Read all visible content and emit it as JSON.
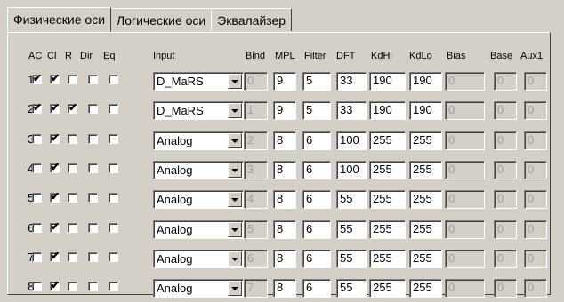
{
  "tabs": [
    "Физические оси",
    "Логические оси",
    "Эквалайзер"
  ],
  "headers": {
    "ac": "AC",
    "cl": "Cl",
    "r": "R",
    "dir": "Dir",
    "eq": "Eq",
    "input": "Input",
    "bind": "Bind",
    "mpl": "MPL",
    "filter": "Filter",
    "dft": "DFT",
    "kdhi": "KdHi",
    "kdlo": "KdLo",
    "bias": "Bias",
    "base": "Base",
    "aux1": "Aux1"
  },
  "rows": [
    {
      "num": "1.",
      "ac": true,
      "cl": true,
      "r": false,
      "dir": false,
      "eq": false,
      "input": "D_MaRS",
      "bind": "0",
      "mpl": "9",
      "filter": "5",
      "dft": "33",
      "kdhi": "190",
      "kdlo": "190",
      "bias": "0",
      "base": "0",
      "aux1": "0"
    },
    {
      "num": "2.",
      "ac": true,
      "cl": true,
      "r": true,
      "dir": false,
      "eq": false,
      "input": "D_MaRS",
      "bind": "1",
      "mpl": "9",
      "filter": "5",
      "dft": "33",
      "kdhi": "190",
      "kdlo": "190",
      "bias": "0",
      "base": "0",
      "aux1": "0"
    },
    {
      "num": "3.",
      "ac": false,
      "cl": true,
      "r": false,
      "dir": false,
      "eq": false,
      "input": "Analog",
      "bind": "2",
      "mpl": "8",
      "filter": "6",
      "dft": "100",
      "kdhi": "255",
      "kdlo": "255",
      "bias": "0",
      "base": "0",
      "aux1": "0"
    },
    {
      "num": "4.",
      "ac": false,
      "cl": true,
      "r": false,
      "dir": false,
      "eq": false,
      "input": "Analog",
      "bind": "3",
      "mpl": "8",
      "filter": "6",
      "dft": "100",
      "kdhi": "255",
      "kdlo": "255",
      "bias": "0",
      "base": "0",
      "aux1": "0"
    },
    {
      "num": "5.",
      "ac": false,
      "cl": true,
      "r": false,
      "dir": false,
      "eq": false,
      "input": "Analog",
      "bind": "4",
      "mpl": "8",
      "filter": "6",
      "dft": "55",
      "kdhi": "255",
      "kdlo": "255",
      "bias": "0",
      "base": "0",
      "aux1": "0"
    },
    {
      "num": "6.",
      "ac": false,
      "cl": true,
      "r": false,
      "dir": false,
      "eq": false,
      "input": "Analog",
      "bind": "5",
      "mpl": "8",
      "filter": "6",
      "dft": "55",
      "kdhi": "255",
      "kdlo": "255",
      "bias": "0",
      "base": "0",
      "aux1": "0"
    },
    {
      "num": "7.",
      "ac": false,
      "cl": true,
      "r": false,
      "dir": false,
      "eq": false,
      "input": "Analog",
      "bind": "6",
      "mpl": "8",
      "filter": "6",
      "dft": "55",
      "kdhi": "255",
      "kdlo": "255",
      "bias": "0",
      "base": "0",
      "aux1": "0"
    },
    {
      "num": "8.",
      "ac": false,
      "cl": true,
      "r": false,
      "dir": false,
      "eq": false,
      "input": "Analog",
      "bind": "7",
      "mpl": "8",
      "filter": "6",
      "dft": "55",
      "kdhi": "255",
      "kdlo": "255",
      "bias": "0",
      "base": "0",
      "aux1": "0"
    }
  ]
}
